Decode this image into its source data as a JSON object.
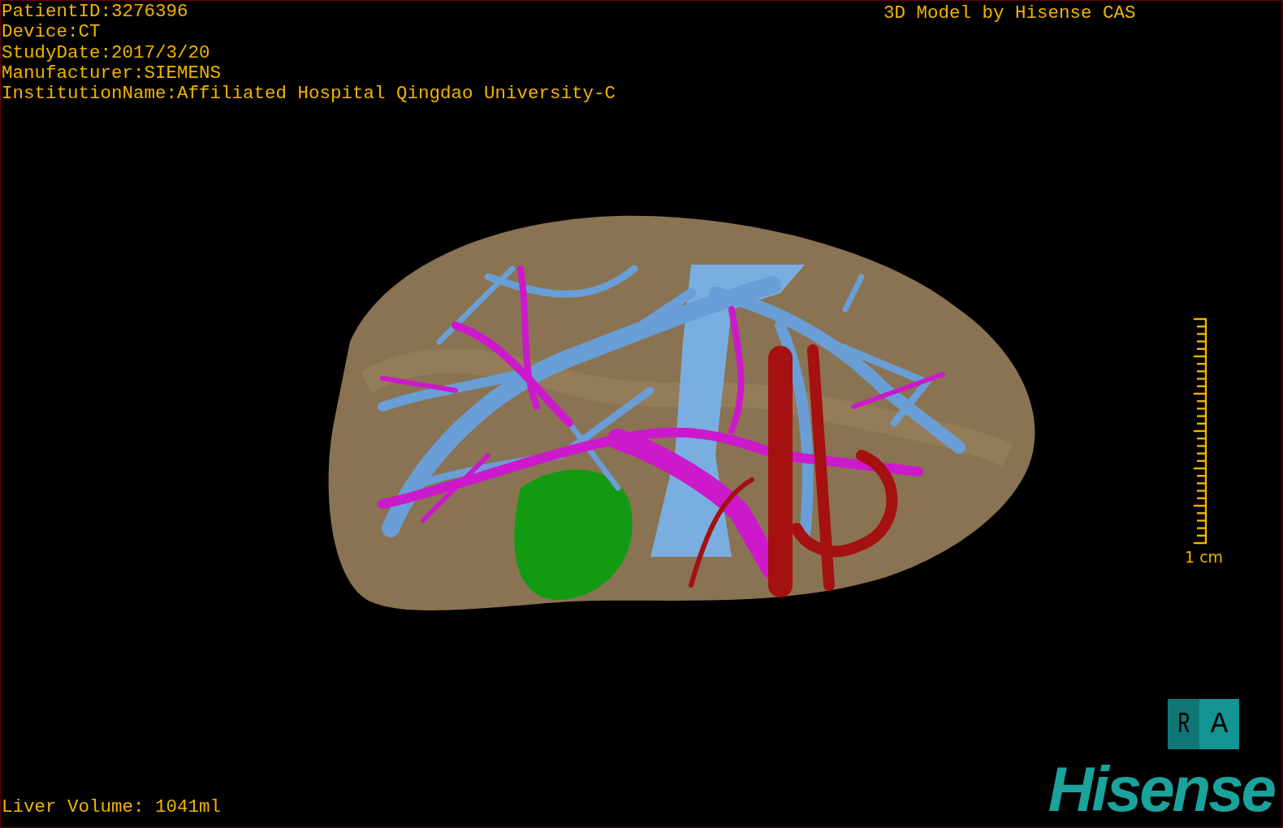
{
  "patient_info": [
    "PatientID:3276396",
    "Device:CT",
    "StudyDate:2017/3/20",
    "Manufacturer:SIEMENS",
    "InstitutionName:Affiliated Hospital Qingdao University-C"
  ],
  "title": "3D Model by Hisense CAS",
  "scale_bar": {
    "label": "1 cm"
  },
  "orientation_cube": {
    "left_face": "R",
    "right_face": "A"
  },
  "logo": "Hisense",
  "liver_volume": "Liver Volume: 1041ml"
}
